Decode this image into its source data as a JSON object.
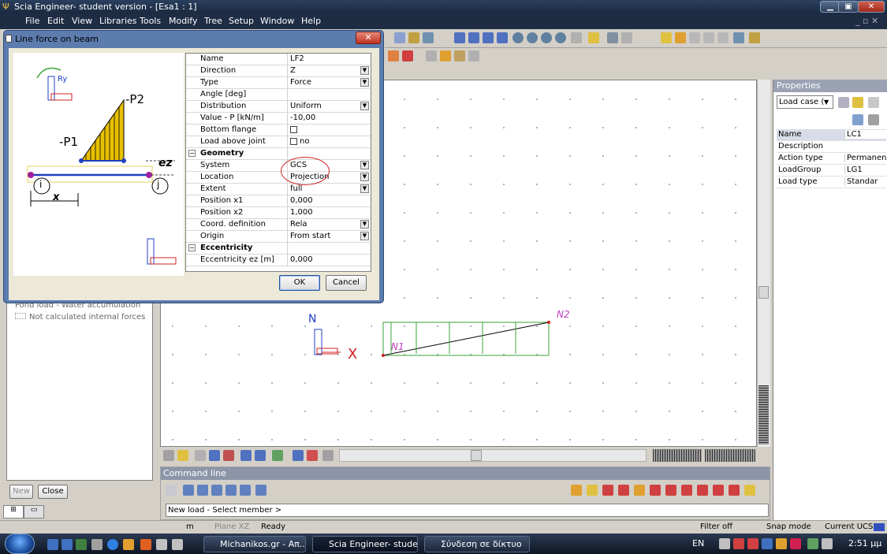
{
  "window": {
    "title": "Scia Engineer- student version - [Esa1 : 1]"
  },
  "menu": [
    "File",
    "Edit",
    "View",
    "Libraries",
    "Tools",
    "Modify",
    "Tree",
    "Setup",
    "Window",
    "Help"
  ],
  "dialog": {
    "title": "Line force on beam",
    "ok_label": "OK",
    "cancel_label": "Cancel",
    "picture_labels": {
      "p1": "-P1",
      "p2": "-P2",
      "ez": "ez",
      "i": "i",
      "j": "j",
      "x": "x",
      "ry": "Ry"
    },
    "rows": [
      {
        "key": "Name",
        "value": "LF2",
        "type": "text"
      },
      {
        "key": "Direction",
        "value": "Z",
        "type": "dropdown"
      },
      {
        "key": "Type",
        "value": "Force",
        "type": "dropdown"
      },
      {
        "key": "Angle [deg]",
        "value": "",
        "type": "text"
      },
      {
        "key": "Distribution",
        "value": "Uniform",
        "type": "dropdown"
      },
      {
        "key": "Value - P [kN/m]",
        "value": "-10,00",
        "type": "text"
      },
      {
        "key": "Bottom flange",
        "value": "",
        "type": "checkbox"
      },
      {
        "key": "Load above joint",
        "value": "no",
        "type": "checkbox"
      },
      {
        "key": "Geometry",
        "value": "",
        "type": "section"
      },
      {
        "key": "System",
        "value": "GCS",
        "type": "dropdown"
      },
      {
        "key": "Location",
        "value": "Projection",
        "type": "dropdown"
      },
      {
        "key": "Extent",
        "value": "full",
        "type": "dropdown"
      },
      {
        "key": "Position x1",
        "value": "0,000",
        "type": "text"
      },
      {
        "key": "Position x2",
        "value": "1,000",
        "type": "text"
      },
      {
        "key": "Coord. definition",
        "value": "Rela",
        "type": "dropdown"
      },
      {
        "key": "Origin",
        "value": "From start",
        "type": "dropdown"
      },
      {
        "key": "Eccentricity",
        "value": "",
        "type": "section"
      },
      {
        "key": "Eccentricity ez [m]",
        "value": "0,000",
        "type": "text"
      }
    ]
  },
  "left_panel": {
    "items": [
      "Pond load - Water accumulation",
      "Not calculated internal forces"
    ],
    "new_label": "New",
    "close_label": "Close"
  },
  "canvas": {
    "node1": "N1",
    "node2": "N2",
    "axis_x": "X",
    "axis_z": "N"
  },
  "properties": {
    "title": "Properties",
    "selector": "Load case (",
    "rows": [
      {
        "key": "Name",
        "value": "LC1"
      },
      {
        "key": "Description",
        "value": ""
      },
      {
        "key": "Action type",
        "value": "Permanen"
      },
      {
        "key": "LoadGroup",
        "value": "LG1"
      },
      {
        "key": "Load type",
        "value": "Standar"
      }
    ]
  },
  "command": {
    "title": "Command line",
    "prompt": "New load - Select member >"
  },
  "status": {
    "unit": "m",
    "plane": "Plane XZ",
    "state": "Ready",
    "filter": "Filter off",
    "snap": "Snap mode",
    "ucs": "Current UCS"
  },
  "taskbar": {
    "tasks": [
      "Michanikos.gr - Απ...",
      "Scia Engineer- stude...",
      "Σύνδεση σε δίκτυο"
    ],
    "lang": "EN",
    "clock": "2:51 μμ"
  },
  "colors": {
    "titlebar": "#1e2c44",
    "dialog_frame": "#5c7cae",
    "load_green": "#3aa33a",
    "node_purple": "#c040c0",
    "highlight_red": "#d02020"
  }
}
